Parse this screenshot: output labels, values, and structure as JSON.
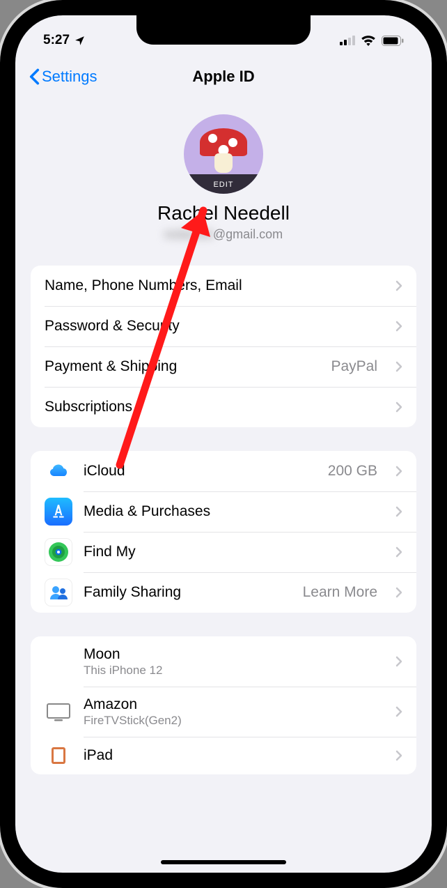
{
  "status": {
    "time": "5:27",
    "location_icon": "location-arrow",
    "cellular": "signal-2-of-4",
    "wifi": "wifi-full",
    "battery": "battery-high"
  },
  "nav": {
    "back_label": "Settings",
    "title": "Apple ID"
  },
  "profile": {
    "edit_label": "EDIT",
    "name": "Rachel Needell",
    "email_hidden": "redacted",
    "email_suffix": "@gmail.com"
  },
  "section1": [
    {
      "label": "Name, Phone Numbers, Email",
      "detail": ""
    },
    {
      "label": "Password & Security",
      "detail": ""
    },
    {
      "label": "Payment & Shipping",
      "detail": "PayPal"
    },
    {
      "label": "Subscriptions",
      "detail": ""
    }
  ],
  "section2": [
    {
      "icon": "icloud",
      "label": "iCloud",
      "detail": "200 GB"
    },
    {
      "icon": "appstore",
      "label": "Media & Purchases",
      "detail": ""
    },
    {
      "icon": "findmy",
      "label": "Find My",
      "detail": ""
    },
    {
      "icon": "family",
      "label": "Family Sharing",
      "detail": "Learn More"
    }
  ],
  "devices": [
    {
      "icon": "none",
      "name": "Moon",
      "sub": "This iPhone 12"
    },
    {
      "icon": "tv",
      "name": "Amazon",
      "sub": "FireTVStick(Gen2)"
    },
    {
      "icon": "ipad",
      "name": "iPad",
      "sub": ""
    }
  ]
}
